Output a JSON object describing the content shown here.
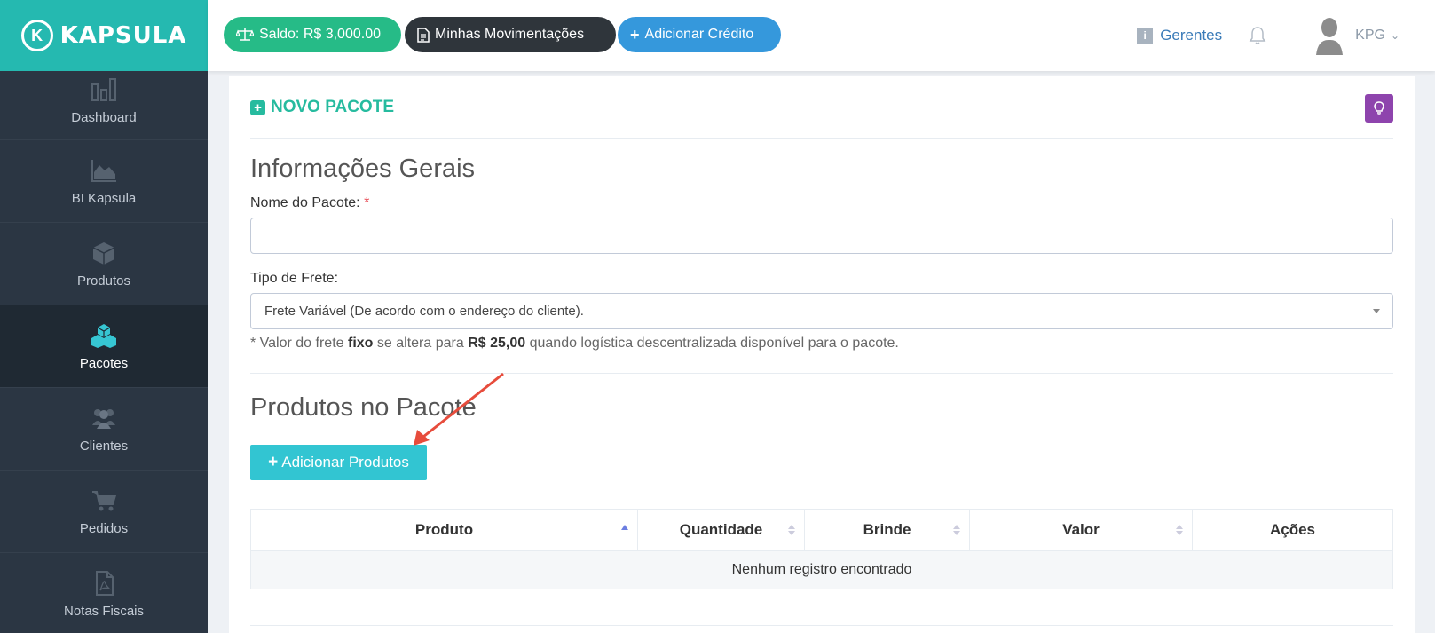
{
  "brand": {
    "name": "KAPSULA",
    "logo_letter": "K"
  },
  "sidebar": {
    "items": [
      {
        "label": "Dashboard",
        "icon": "bar-chart-icon",
        "active": false
      },
      {
        "label": "BI Kapsula",
        "icon": "area-chart-icon",
        "active": false
      },
      {
        "label": "Produtos",
        "icon": "cube-icon",
        "active": false
      },
      {
        "label": "Pacotes",
        "icon": "cubes-icon",
        "active": true
      },
      {
        "label": "Clientes",
        "icon": "users-icon",
        "active": false
      },
      {
        "label": "Pedidos",
        "icon": "shopping-cart-icon",
        "active": false
      },
      {
        "label": "Notas Fiscais",
        "icon": "pdf-file-icon",
        "active": false
      }
    ]
  },
  "header": {
    "saldo_label": "Saldo: R$ 3,000.00",
    "movimentacoes_label": "Minhas Movimentações",
    "add_credit_label": "Adicionar Crédito",
    "gerentes_label": "Gerentes",
    "user_name": "KPG"
  },
  "page": {
    "title": "NOVO PACOTE",
    "general_section_title": "Informações Gerais",
    "package_name_label": "Nome do Pacote:",
    "required_mark": "*",
    "package_name_value": "",
    "freight_label": "Tipo de Frete:",
    "freight_selected": "Frete Variável (De acordo com o endereço do cliente).",
    "freight_note_prefix": "* Valor do frete",
    "freight_note_bold1": "fixo",
    "freight_note_mid": "se altera para",
    "freight_note_bold2": "R$ 25,00",
    "freight_note_suffix": "quando logística descentralizada disponível para o pacote.",
    "products_section_title": "Produtos no Pacote",
    "add_products_label": "Adicionar Produtos"
  },
  "table": {
    "columns": [
      "Produto",
      "Quantidade",
      "Brinde",
      "Valor",
      "Ações"
    ],
    "empty_message": "Nenhum registro encontrado"
  },
  "colors": {
    "brand": "#25b9b0",
    "sidebar": "#2b3643",
    "saldo_button": "#26bb87",
    "movimentacoes_button": "#2f353b",
    "add_credit_button": "#3598dc",
    "add_products_button": "#32c5d2",
    "title_green": "#26bb9f",
    "bulb_button": "#8e44ad",
    "annotation_arrow": "#e74c3c"
  }
}
